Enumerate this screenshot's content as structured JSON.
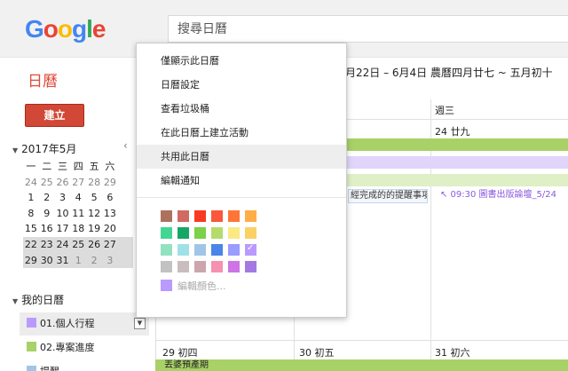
{
  "header": {
    "logo_letters": [
      {
        "ch": "G",
        "color": "#4285f4"
      },
      {
        "ch": "o",
        "color": "#ea4335"
      },
      {
        "ch": "o",
        "color": "#fbbc05"
      },
      {
        "ch": "g",
        "color": "#4285f4"
      },
      {
        "ch": "l",
        "color": "#34a853"
      },
      {
        "ch": "e",
        "color": "#ea4335"
      }
    ],
    "search_placeholder": "搜尋日曆"
  },
  "app_title": "日曆",
  "date_range": "月22日 – 6月4日 農曆四月廿七 ~ 五月初十",
  "create_button": "建立",
  "mini_calendar": {
    "title": "2017年5月",
    "nav_prev": "‹",
    "weekdays": [
      "一",
      "二",
      "三",
      "四",
      "五",
      "六"
    ],
    "weeks": [
      {
        "days": [
          "24",
          "25",
          "26",
          "27",
          "28",
          "29"
        ],
        "dim": [
          true,
          true,
          true,
          true,
          true,
          true
        ],
        "shade": false
      },
      {
        "days": [
          "1",
          "2",
          "3",
          "4",
          "5",
          "6"
        ],
        "dim": [
          false,
          false,
          false,
          false,
          false,
          false
        ],
        "shade": false
      },
      {
        "days": [
          "8",
          "9",
          "10",
          "11",
          "12",
          "13"
        ],
        "dim": [
          false,
          false,
          false,
          false,
          false,
          false
        ],
        "shade": false
      },
      {
        "days": [
          "15",
          "16",
          "17",
          "18",
          "19",
          "20"
        ],
        "dim": [
          false,
          false,
          false,
          false,
          false,
          false
        ],
        "shade": false
      },
      {
        "days": [
          "22",
          "23",
          "24",
          "25",
          "26",
          "27"
        ],
        "dim": [
          false,
          false,
          false,
          false,
          false,
          false
        ],
        "shade": true
      },
      {
        "days": [
          "29",
          "30",
          "31",
          "1",
          "2",
          "3"
        ],
        "dim": [
          false,
          false,
          false,
          true,
          true,
          true
        ],
        "shade": true
      }
    ]
  },
  "my_calendars": {
    "title": "我的日曆",
    "items": [
      {
        "label": "01.個人行程",
        "color": "#b99aff"
      },
      {
        "label": "02.專案進度",
        "color": "#a8d167"
      },
      {
        "label": "提醒",
        "color": "#9fc6e7"
      }
    ]
  },
  "grid": {
    "col_header_wed": "週三",
    "week1": {
      "wed": "24 廿九"
    },
    "chip_task": "經完成的的提醒事項",
    "chip_event": "↖ 09:30 圖書出版論壇_5/24",
    "week2": {
      "mon": "29 初四",
      "tue": "30 初五",
      "wed": "31 初六"
    },
    "bottom_event": "丟婆預產期",
    "colors": {
      "green": "#a8d167",
      "purple": "#b99aff",
      "purple_light": "#e1d5fb",
      "green_light": "#dff0c6"
    }
  },
  "menu": {
    "items": [
      {
        "label": "僅顯示此日曆",
        "hover": false
      },
      {
        "label": "日曆設定",
        "hover": false
      },
      {
        "label": "查看垃圾桶",
        "hover": false
      },
      {
        "label": "在此日曆上建立活動",
        "hover": false
      },
      {
        "label": "共用此日曆",
        "hover": true
      },
      {
        "label": "編輯通知",
        "hover": false
      }
    ],
    "colors": [
      [
        "#ac725e",
        "#d06b64",
        "#f83a22",
        "#fa573c",
        "#ff7537",
        "#ffad46"
      ],
      [
        "#42d692",
        "#16a765",
        "#7bd148",
        "#b3dc6c",
        "#fbe983",
        "#fad165"
      ],
      [
        "#92e1c0",
        "#9fe1e7",
        "#9fc6e7",
        "#4986e7",
        "#9a9cff",
        "#b99aff"
      ],
      [
        "#c2c2c2",
        "#cabdbf",
        "#cca6ac",
        "#f691b2",
        "#cd74e6",
        "#a47ae2"
      ]
    ],
    "checked": {
      "row": 2,
      "col": 5
    },
    "custom_color": "編輯顏色..."
  }
}
